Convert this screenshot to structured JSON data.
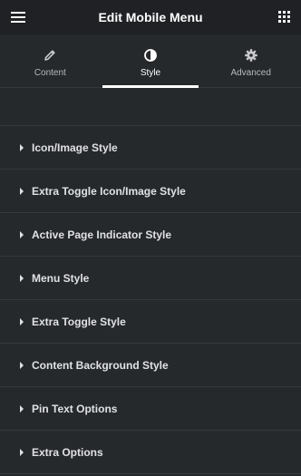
{
  "header": {
    "title": "Edit Mobile Menu",
    "menu_icon": "hamburger-icon",
    "apps_icon": "grid-icon"
  },
  "tabs": [
    {
      "label": "Content",
      "icon": "pencil-icon",
      "active": false
    },
    {
      "label": "Style",
      "icon": "half-circle-icon",
      "active": true
    },
    {
      "label": "Advanced",
      "icon": "gear-icon",
      "active": false
    }
  ],
  "sections": [
    {
      "label": "Icon/Image Style"
    },
    {
      "label": "Extra Toggle Icon/Image Style"
    },
    {
      "label": "Active Page Indicator Style"
    },
    {
      "label": "Menu Style"
    },
    {
      "label": "Extra Toggle Style"
    },
    {
      "label": "Content Background Style"
    },
    {
      "label": "Pin Text Options"
    },
    {
      "label": "Extra Options"
    }
  ],
  "colors": {
    "header_bg": "#1f2124",
    "panel_bg": "#26292c",
    "divider": "#35383c",
    "text": "#e0e1e3",
    "active_indicator": "#ffffff"
  }
}
